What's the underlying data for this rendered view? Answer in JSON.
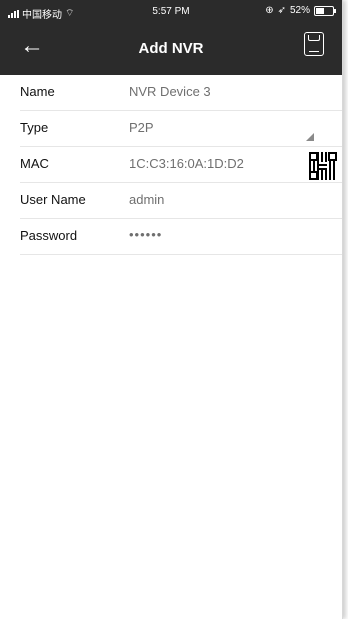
{
  "status_bar": {
    "carrier": "中国移动",
    "time": "5:57 PM",
    "battery": "52%"
  },
  "nav": {
    "title": "Add NVR",
    "back_icon": "arrow-left-icon",
    "save_icon": "save-icon"
  },
  "form": {
    "rows": [
      {
        "label": "Name",
        "value": "NVR Device 3"
      },
      {
        "label": "Type",
        "value": "P2P"
      },
      {
        "label": "MAC",
        "value": "1C:C3:16:0A:1D:D2"
      },
      {
        "label": "User Name",
        "value": "admin"
      },
      {
        "label": "Password",
        "value": "••••••"
      }
    ]
  },
  "colors": {
    "header_bg": "#2b2b2b",
    "header_text": "#ffffff",
    "label_text": "#111111",
    "value_text": "#6f6f6f",
    "divider": "#e6e6e6"
  }
}
